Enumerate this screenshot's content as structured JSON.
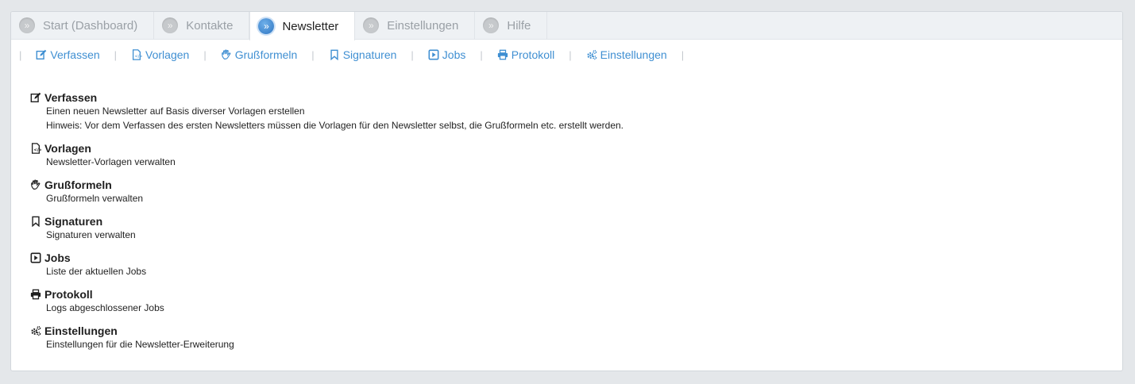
{
  "tabs": [
    {
      "label": "Start (Dashboard)",
      "active": false
    },
    {
      "label": "Kontakte",
      "active": false
    },
    {
      "label": "Newsletter",
      "active": true
    },
    {
      "label": "Einstellungen",
      "active": false
    },
    {
      "label": "Hilfe",
      "active": false
    }
  ],
  "tab_bullet": "»",
  "subnav": {
    "separator": "|",
    "items": [
      {
        "label": "Verfassen",
        "icon": "edit-icon"
      },
      {
        "label": "Vorlagen",
        "icon": "template-icon"
      },
      {
        "label": "Grußformeln",
        "icon": "hand-icon"
      },
      {
        "label": "Signaturen",
        "icon": "bookmark-icon"
      },
      {
        "label": "Jobs",
        "icon": "play-icon"
      },
      {
        "label": "Protokoll",
        "icon": "printer-icon"
      },
      {
        "label": "Einstellungen",
        "icon": "gears-icon"
      }
    ]
  },
  "sections": [
    {
      "title": "Verfassen",
      "icon": "edit-icon",
      "lines": [
        "Einen neuen Newsletter auf Basis diverser Vorlagen erstellen",
        "Hinweis: Vor dem Verfassen des ersten Newsletters müssen die Vorlagen für den Newsletter selbst, die Grußformeln etc. erstellt werden."
      ]
    },
    {
      "title": "Vorlagen",
      "icon": "template-icon",
      "lines": [
        "Newsletter-Vorlagen verwalten"
      ]
    },
    {
      "title": "Grußformeln",
      "icon": "hand-icon",
      "lines": [
        "Grußformeln verwalten"
      ]
    },
    {
      "title": "Signaturen",
      "icon": "bookmark-icon",
      "lines": [
        "Signaturen verwalten"
      ]
    },
    {
      "title": "Jobs",
      "icon": "play-icon",
      "lines": [
        "Liste der aktuellen Jobs"
      ]
    },
    {
      "title": "Protokoll",
      "icon": "printer-icon",
      "lines": [
        "Logs abgeschlossener Jobs"
      ]
    },
    {
      "title": "Einstellungen",
      "icon": "gears-icon",
      "lines": [
        "Einstellungen für die Newsletter-Erweiterung"
      ]
    }
  ],
  "colors": {
    "link": "#3f8fd2",
    "active_tab_bullet": "#2f76c2"
  }
}
